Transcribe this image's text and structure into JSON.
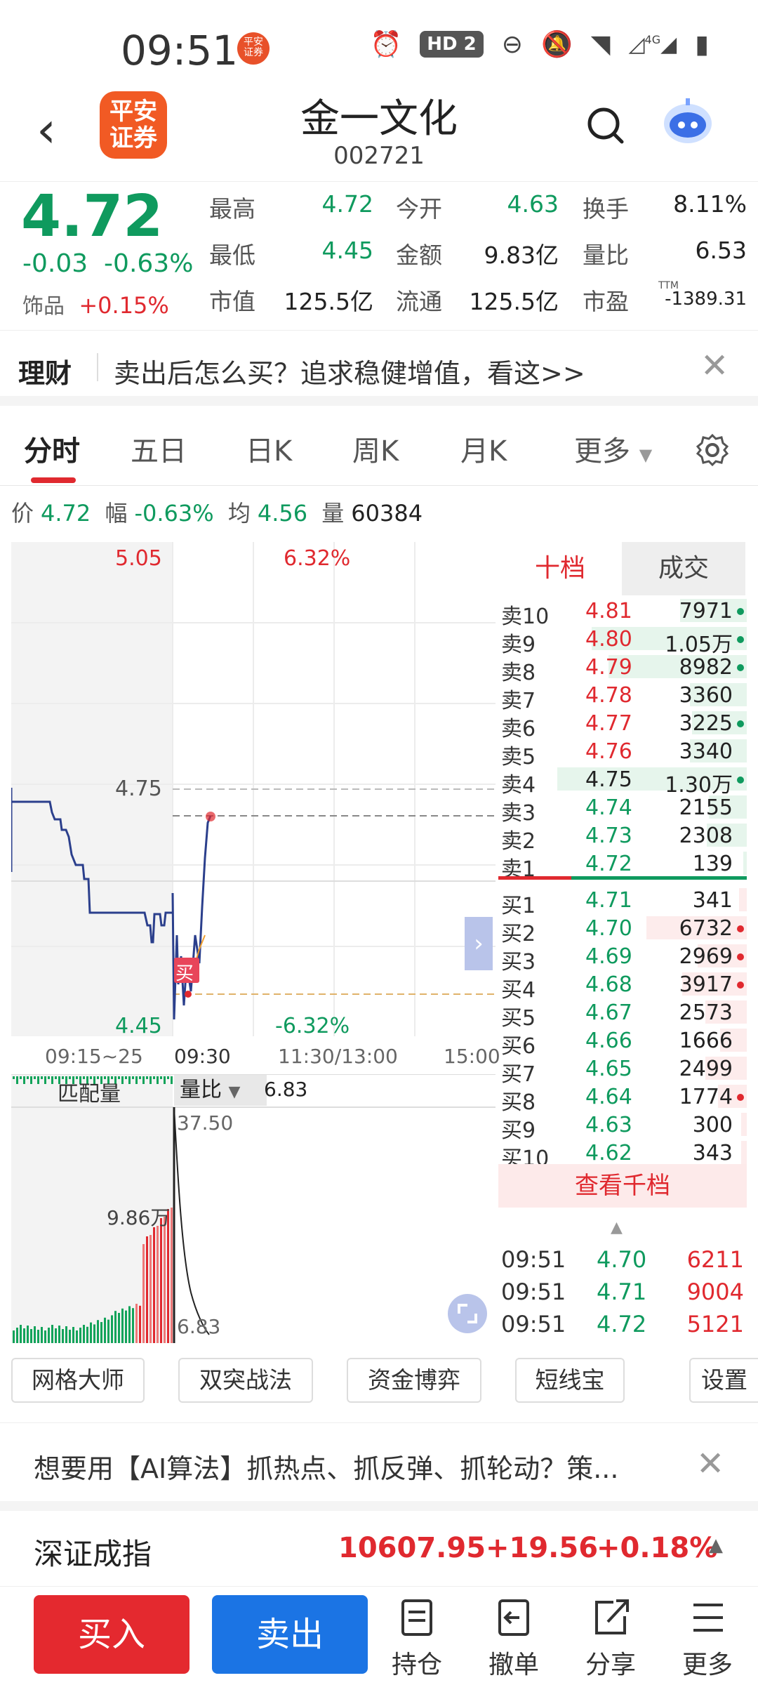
{
  "status_bar": {
    "time": "09:51",
    "badge": "平安证券",
    "hd": "HD 2",
    "net": "4G"
  },
  "header": {
    "logo_text": "平安证券",
    "title": "金一文化",
    "code": "002721"
  },
  "quote": {
    "price": "4.72",
    "change": "-0.03",
    "change_pct": "-0.63%",
    "sector_label": "饰品",
    "sector_pct": "+0.15%",
    "fields": [
      {
        "k": "最高",
        "v": "4.72",
        "c": "green"
      },
      {
        "k": "今开",
        "v": "4.63",
        "c": "green"
      },
      {
        "k": "换手",
        "v": "8.11%",
        "c": "dark"
      },
      {
        "k": "最低",
        "v": "4.45",
        "c": "green"
      },
      {
        "k": "金额",
        "v": "9.83亿",
        "c": "dark"
      },
      {
        "k": "量比",
        "v": "6.53",
        "c": "dark"
      },
      {
        "k": "市值",
        "v": "125.5亿",
        "c": "dark"
      },
      {
        "k": "流通",
        "v": "125.5亿",
        "c": "dark"
      },
      {
        "k": "市盈",
        "v": "-1389.31",
        "c": "dark"
      }
    ],
    "ttm": "TTM"
  },
  "promo": {
    "tag": "理财",
    "text": "卖出后怎么买？追求稳健增值，看这>>"
  },
  "tabs": [
    "分时",
    "五日",
    "日K",
    "周K",
    "月K",
    "更多"
  ],
  "info_line": {
    "price_k": "价",
    "price_v": "4.72",
    "amp_k": "幅",
    "amp_v": "-0.63%",
    "avg_k": "均",
    "avg_v": "4.56",
    "vol_k": "量",
    "vol_v": "60384"
  },
  "chart_data": {
    "type": "line",
    "y_max": "5.05",
    "y_max_pct": "6.32%",
    "y_min": "4.45",
    "y_min_pct": "-6.32%",
    "ref_line": "4.75",
    "x_labels": [
      "09:15~25",
      "09:30",
      "11:30/13:00",
      "15:00"
    ],
    "buy_marker": "买",
    "sub_labels": {
      "match": "匹配量",
      "ratio": "量比",
      "ratio_val": "6.83",
      "top": "37.50",
      "mid": "9.86万",
      "bottom": "6.83"
    }
  },
  "book": {
    "tabs": [
      "十档",
      "成交"
    ],
    "asks": [
      {
        "n": "卖10",
        "p": "4.81",
        "v": "7971",
        "w": 0.35,
        "pc": "red",
        "dot": "green"
      },
      {
        "n": "卖9",
        "p": "4.80",
        "v": "1.05万",
        "w": 0.82,
        "pc": "red",
        "dot": "green"
      },
      {
        "n": "卖8",
        "p": "4.79",
        "v": "8982",
        "w": 0.73,
        "pc": "red",
        "dot": "green"
      },
      {
        "n": "卖7",
        "p": "4.78",
        "v": "3360",
        "w": 0.3,
        "pc": "red",
        "dot": ""
      },
      {
        "n": "卖6",
        "p": "4.77",
        "v": "3225",
        "w": 0.29,
        "pc": "red",
        "dot": "green"
      },
      {
        "n": "卖5",
        "p": "4.76",
        "v": "3340",
        "w": 0.3,
        "pc": "red",
        "dot": ""
      },
      {
        "n": "卖4",
        "p": "4.75",
        "v": "1.30万",
        "w": 1.0,
        "pc": "dark",
        "dot": "green"
      },
      {
        "n": "卖3",
        "p": "4.74",
        "v": "2155",
        "w": 0.2,
        "pc": "green",
        "dot": ""
      },
      {
        "n": "卖2",
        "p": "4.73",
        "v": "2308",
        "w": 0.21,
        "pc": "green",
        "dot": ""
      },
      {
        "n": "卖1",
        "p": "4.72",
        "v": "139",
        "w": 0.02,
        "pc": "green",
        "dot": ""
      }
    ],
    "bids": [
      {
        "n": "买1",
        "p": "4.71",
        "v": "341",
        "w": 0.04,
        "dot": ""
      },
      {
        "n": "买2",
        "p": "4.70",
        "v": "6732",
        "w": 0.53,
        "dot": "red"
      },
      {
        "n": "买3",
        "p": "4.69",
        "v": "2969",
        "w": 0.26,
        "dot": "red"
      },
      {
        "n": "买4",
        "p": "4.68",
        "v": "3917",
        "w": 0.34,
        "dot": "red"
      },
      {
        "n": "买5",
        "p": "4.67",
        "v": "2573",
        "w": 0.22,
        "dot": ""
      },
      {
        "n": "买6",
        "p": "4.66",
        "v": "1666",
        "w": 0.14,
        "dot": ""
      },
      {
        "n": "买7",
        "p": "4.65",
        "v": "2499",
        "w": 0.22,
        "dot": ""
      },
      {
        "n": "买8",
        "p": "4.64",
        "v": "1774",
        "w": 0.15,
        "dot": "red"
      },
      {
        "n": "买9",
        "p": "4.63",
        "v": "300",
        "w": 0.03,
        "dot": ""
      },
      {
        "n": "买10",
        "p": "4.62",
        "v": "343",
        "w": 0.03,
        "dot": ""
      }
    ],
    "view_more": "查看千档",
    "trades": [
      {
        "t": "09:51",
        "p": "4.70",
        "v": "6211"
      },
      {
        "t": "09:51",
        "p": "4.71",
        "v": "9004"
      },
      {
        "t": "09:51",
        "p": "4.72",
        "v": "5121"
      }
    ]
  },
  "quick_links": [
    "网格大师",
    "双突战法",
    "资金博弈",
    "短线宝",
    "设置"
  ],
  "ai_bar": {
    "text": "想要用【AI算法】抓热点、抓反弹、抓轮动？策..."
  },
  "index": {
    "name": "深证成指",
    "value": "10607.95",
    "change": "+19.56",
    "pct": "+0.18%"
  },
  "bottom_nav": {
    "buy": "买入",
    "sell": "卖出",
    "items": [
      "持仓",
      "撤单",
      "分享",
      "更多"
    ]
  }
}
